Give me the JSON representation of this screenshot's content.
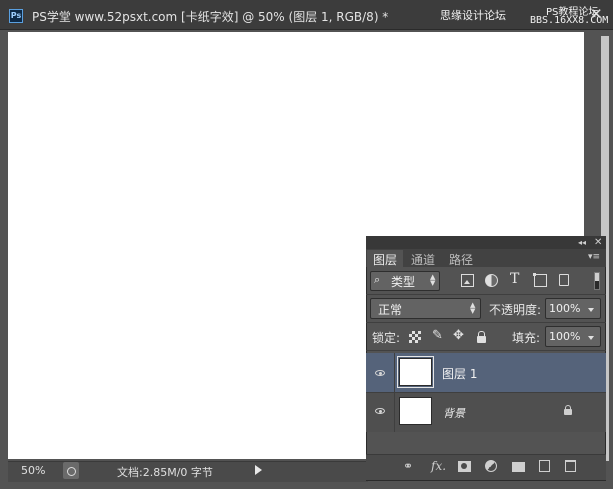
{
  "window": {
    "app_icon_label": "Ps",
    "title": "PS学堂 www.52psxt.com [卡纸字效] @ 50% (图层 1, RGB/8) *",
    "close_symbol": "✕",
    "watermark_line1": "思缘设计论坛",
    "watermark_line2": "PS教程论坛",
    "watermark_line3": "BBS.16XX8.COM"
  },
  "status_bar": {
    "zoom": "50%",
    "doc_info": "文档:2.85M/0 字节"
  },
  "layers_panel": {
    "tabs": [
      {
        "label": "图层",
        "active": true
      },
      {
        "label": "通道",
        "active": false
      },
      {
        "label": "路径",
        "active": false
      }
    ],
    "filter": {
      "search_icon": "⌕",
      "label": "类型"
    },
    "blend_mode": "正常",
    "opacity_label": "不透明度:",
    "opacity_value": "100%",
    "lock_label": "锁定:",
    "fill_label": "填充:",
    "fill_value": "100%",
    "layers": [
      {
        "name": "图层 1",
        "selected": true,
        "visible": true
      },
      {
        "name": "背景",
        "selected": false,
        "visible": true,
        "locked": true
      }
    ],
    "footer": {
      "link_symbol": "⚭",
      "fx_label": "fx."
    }
  },
  "colors": {
    "canvas": "#ffffff",
    "workspace": "#535353",
    "selected_layer": "#55637a"
  }
}
